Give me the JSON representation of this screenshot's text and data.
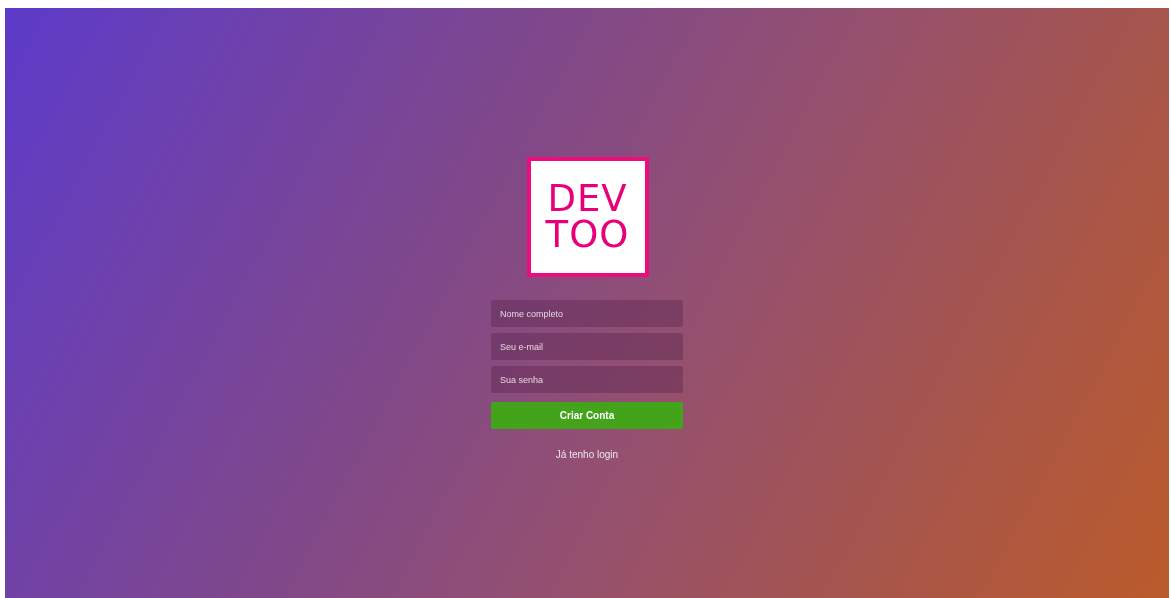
{
  "logo": {
    "lines": [
      "DEV",
      "TOO"
    ]
  },
  "form": {
    "fields": [
      {
        "placeholder": "Nome completo"
      },
      {
        "placeholder": "Seu e-mail"
      },
      {
        "placeholder": "Sua senha"
      }
    ],
    "submit": "Criar Conta",
    "login_link": "Já tenho login"
  }
}
